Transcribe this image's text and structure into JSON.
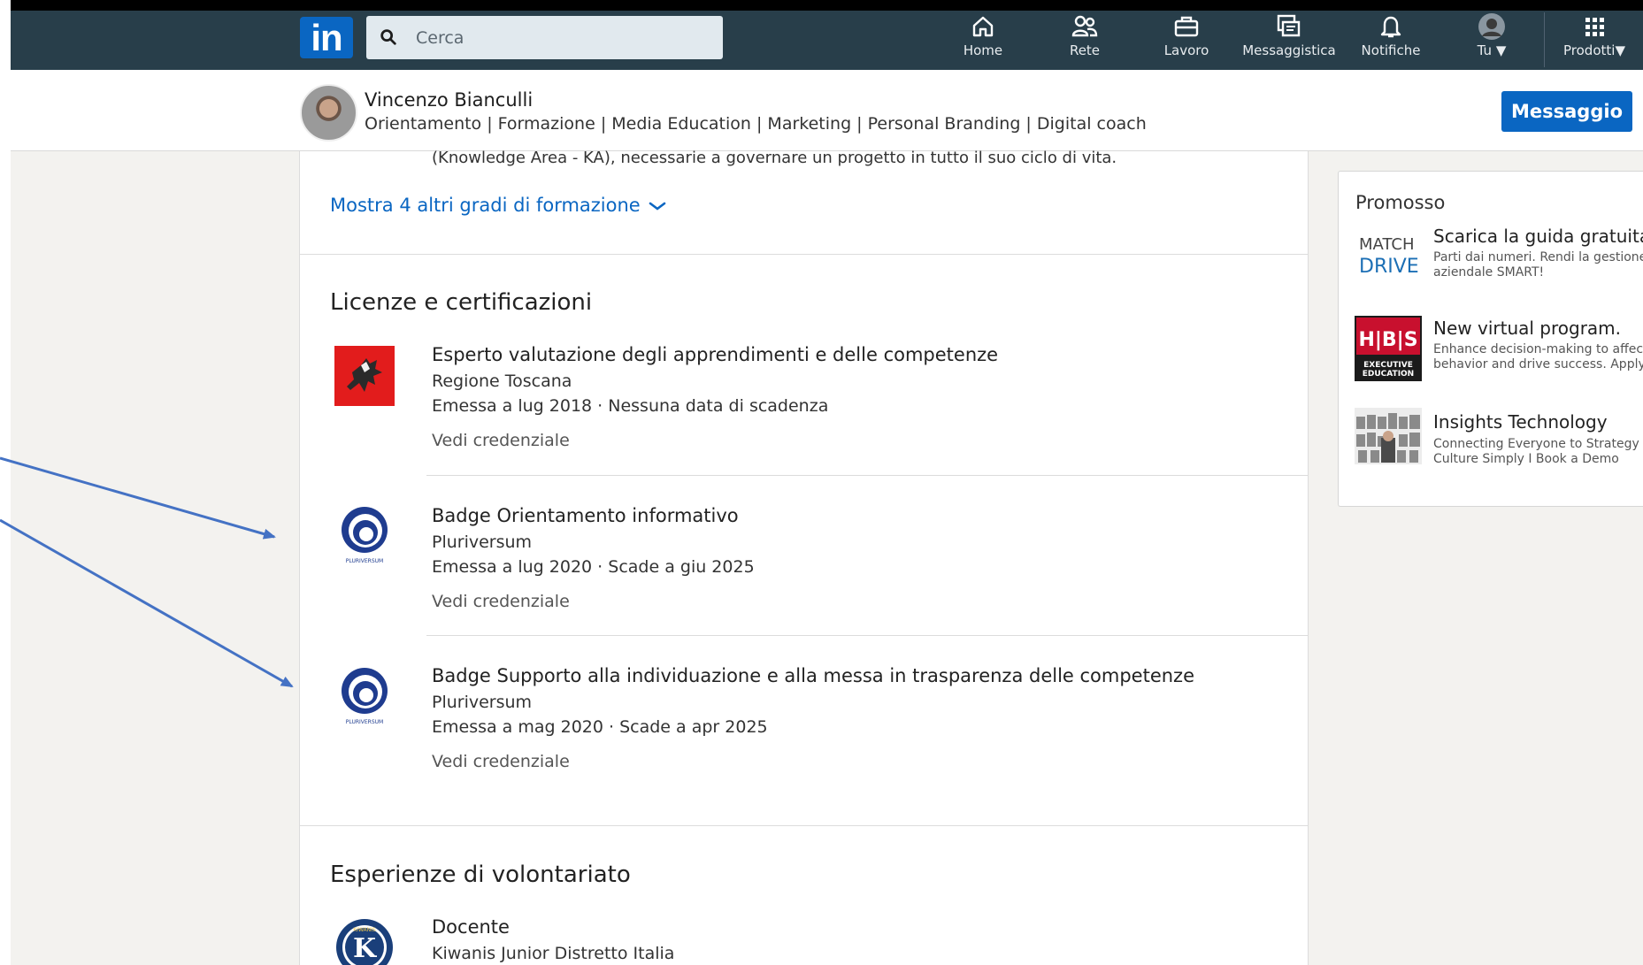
{
  "nav": {
    "logo_text": "in",
    "search_placeholder": "Cerca",
    "items": [
      {
        "label": "Home",
        "icon": "home-icon"
      },
      {
        "label": "Rete",
        "icon": "network-icon"
      },
      {
        "label": "Lavoro",
        "icon": "briefcase-icon"
      },
      {
        "label": "Messaggistica",
        "icon": "messaging-icon"
      },
      {
        "label": "Notifiche",
        "icon": "bell-icon"
      },
      {
        "label": "Tu",
        "icon": "avatar-icon"
      },
      {
        "label": "Prodotti",
        "icon": "grid-icon"
      }
    ]
  },
  "profile": {
    "name": "Vincenzo Bianculli",
    "headline": "Orientamento | Formazione | Media Education | Marketing | Personal Branding | Digital coach",
    "message_button": "Messaggio"
  },
  "education": {
    "cut_text": "(Knowledge Area - KA), necessarie a governare un progetto in tutto il suo ciclo di vita.",
    "show_more": "Mostra 4 altri gradi di formazione"
  },
  "licenses": {
    "title": "Licenze e certificazioni",
    "items": [
      {
        "title": "Esperto valutazione degli apprendimenti e delle competenze",
        "issuer": "Regione Toscana",
        "dates": "Emessa a lug 2018 · Nessuna data di scadenza",
        "link": "Vedi credenziale",
        "logo": "regione-toscana-logo"
      },
      {
        "title": "Badge Orientamento informativo",
        "issuer": "Pluriversum",
        "dates": "Emessa a lug 2020 · Scade a giu 2025",
        "link": "Vedi credenziale",
        "logo": "pluriversum-logo",
        "logo_text": "PLURIVERSUM"
      },
      {
        "title": "Badge Supporto alla individuazione e alla messa in trasparenza delle competenze",
        "issuer": "Pluriversum",
        "dates": "Emessa a mag 2020 · Scade a apr 2025",
        "link": "Vedi credenziale",
        "logo": "pluriversum-logo",
        "logo_text": "PLURIVERSUM"
      }
    ]
  },
  "volunteer": {
    "title": "Esperienze di volontariato",
    "items": [
      {
        "role": "Docente",
        "org": "Kiwanis Junior Distretto Italia",
        "logo": "kiwanis-logo",
        "logo_text": "KIWANIS"
      }
    ]
  },
  "promoted": {
    "title": "Promosso",
    "ads": [
      {
        "logo_lines": [
          "MATCH",
          "DRIVE"
        ],
        "title": "Scarica la guida gratuita",
        "desc_line1": "Parti dai numeri. Rendi la gestione",
        "desc_line2": "aziendale SMART!"
      },
      {
        "logo_lines": [
          "H|B|S",
          "EXECUTIVE",
          "EDUCATION"
        ],
        "title": "New virtual program.",
        "desc_line1": "Enhance decision-making to affect",
        "desc_line2": "behavior and drive success. Apply"
      },
      {
        "logo_lines": [],
        "title": "Insights Technology",
        "desc_line1": "Connecting Everyone to Strategy and",
        "desc_line2": "Culture Simply I Book a Demo"
      }
    ]
  },
  "colors": {
    "nav_bg": "#283e4a",
    "linkedin_blue": "#0a66c2",
    "page_bg": "#f3f2ef",
    "arrow": "#4472c4"
  }
}
